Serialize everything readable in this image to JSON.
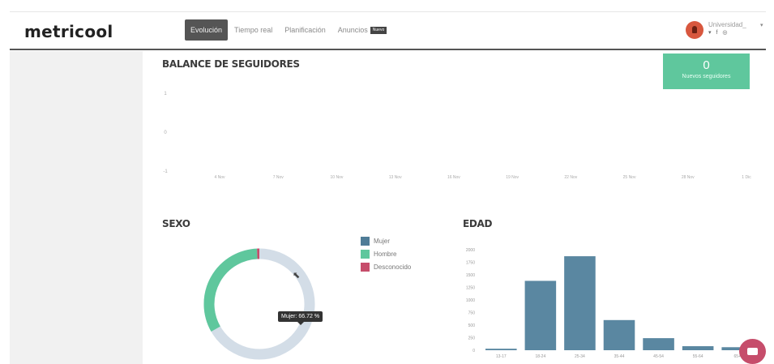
{
  "app": {
    "logo": "metricool",
    "nav": [
      {
        "label": "Evolución",
        "active": true
      },
      {
        "label": "Tiempo real",
        "active": false
      },
      {
        "label": "Planificación",
        "active": false
      },
      {
        "label": "Anuncios",
        "active": false,
        "badge": "Nuevo"
      }
    ],
    "account": {
      "name": "Universidad_",
      "icons": "▾ f ◎"
    }
  },
  "colors": {
    "mujer": "#4f7c97",
    "hombre": "#5fc79d",
    "desconocido": "#c64d6b",
    "bar": "#5a87a1",
    "donut_track": "#d3dde7"
  },
  "balance": {
    "title": "BALANCE DE SEGUIDORES",
    "kpi_value": "0",
    "kpi_label": "Nuevos seguidores"
  },
  "sexo": {
    "title": "SEXO",
    "legend": [
      "Mujer",
      "Hombre",
      "Desconocido"
    ],
    "tooltip": "Mujer: 66.72 %"
  },
  "edad": {
    "title": "EDAD"
  },
  "chart_data": [
    {
      "type": "line",
      "title": "BALANCE DE SEGUIDORES",
      "yticks": [
        "1",
        "0",
        "-1"
      ],
      "categories": [
        "4 Nov",
        "7 Nov",
        "10 Nov",
        "13 Nov",
        "16 Nov",
        "19 Nov",
        "22 Nov",
        "25 Nov",
        "28 Nov",
        "1 Dic"
      ],
      "ylim": [
        -1,
        1
      ]
    },
    {
      "type": "pie",
      "title": "SEXO",
      "categories": [
        "Mujer",
        "Hombre",
        "Desconocido"
      ],
      "values": [
        66.72,
        32.6,
        0.68
      ]
    },
    {
      "type": "bar",
      "title": "EDAD",
      "categories": [
        "13-17",
        "18-24",
        "25-34",
        "35-44",
        "45-54",
        "55-64",
        "65+"
      ],
      "values": [
        30,
        1380,
        1870,
        600,
        240,
        80,
        60
      ],
      "yticks": [
        "2000",
        "1750",
        "1500",
        "1250",
        "1000",
        "750",
        "500",
        "250",
        "0"
      ],
      "ylim": [
        0,
        2000
      ]
    }
  ]
}
